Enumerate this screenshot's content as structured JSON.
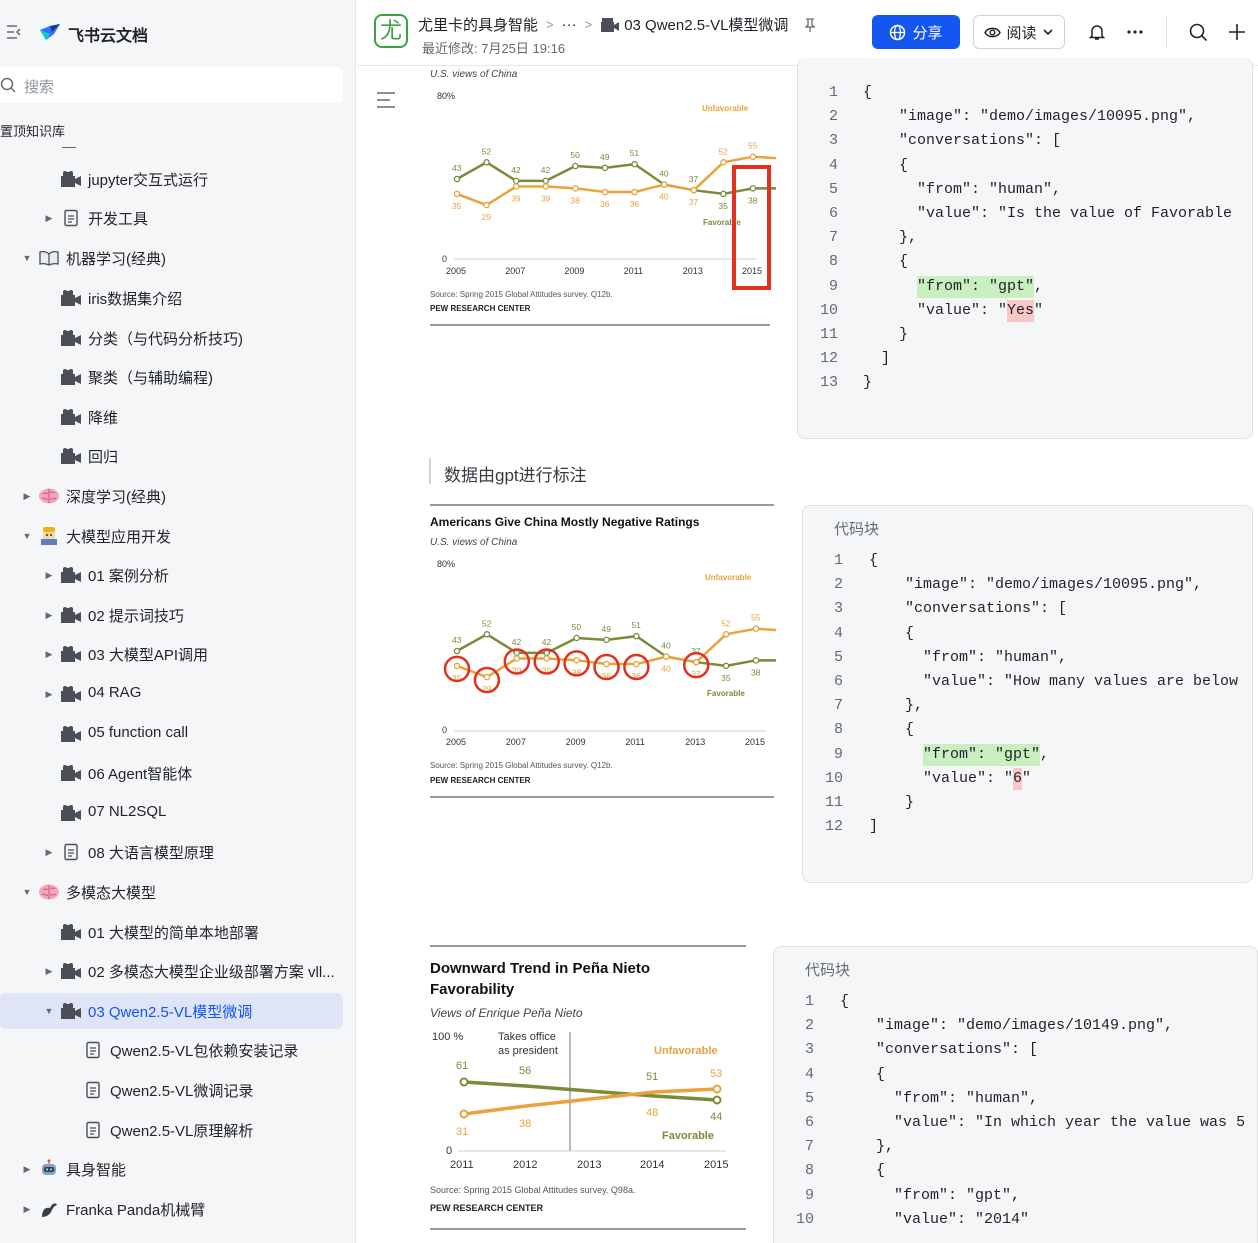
{
  "app": {
    "name": "飞书云文档"
  },
  "sidebar": {
    "search_placeholder": "搜索",
    "pinned_label": "置顶知识库",
    "items": [
      {
        "label": "jupyter交互式运行",
        "icon": "video-icon",
        "level": 2,
        "arrow": ""
      },
      {
        "label": "开发工具",
        "icon": "doc-icon",
        "level": 2,
        "arrow": "right"
      },
      {
        "label": "机器学习(经典)",
        "icon": "book-icon",
        "level": 1,
        "arrow": "down"
      },
      {
        "label": "iris数据集介绍",
        "icon": "video-icon",
        "level": 2,
        "arrow": ""
      },
      {
        "label": "分类（与代码分析技巧)",
        "icon": "video-icon",
        "level": 2,
        "arrow": ""
      },
      {
        "label": "聚类（与辅助编程)",
        "icon": "video-icon",
        "level": 2,
        "arrow": ""
      },
      {
        "label": "降维",
        "icon": "video-icon",
        "level": 2,
        "arrow": ""
      },
      {
        "label": "回归",
        "icon": "video-icon",
        "level": 2,
        "arrow": ""
      },
      {
        "label": "深度学习(经典)",
        "icon": "brain-icon",
        "level": 1,
        "arrow": "right"
      },
      {
        "label": "大模型应用开发",
        "icon": "robot-worker-icon",
        "level": 1,
        "arrow": "down"
      },
      {
        "label": "01 案例分析",
        "icon": "video-icon",
        "level": 2,
        "arrow": "right"
      },
      {
        "label": "02 提示词技巧",
        "icon": "video-icon",
        "level": 2,
        "arrow": "right"
      },
      {
        "label": "03 大模型API调用",
        "icon": "video-icon",
        "level": 2,
        "arrow": "right"
      },
      {
        "label": "04 RAG",
        "icon": "video-icon",
        "level": 2,
        "arrow": "right"
      },
      {
        "label": "05 function call",
        "icon": "video-icon",
        "level": 2,
        "arrow": ""
      },
      {
        "label": "06 Agent智能体",
        "icon": "video-icon",
        "level": 2,
        "arrow": ""
      },
      {
        "label": "07 NL2SQL",
        "icon": "video-icon",
        "level": 2,
        "arrow": ""
      },
      {
        "label": "08 大语言模型原理",
        "icon": "doc-icon",
        "level": 2,
        "arrow": "right"
      },
      {
        "label": "多模态大模型",
        "icon": "brain-icon",
        "level": 1,
        "arrow": "down"
      },
      {
        "label": "01 大模型的简单本地部署",
        "icon": "video-icon",
        "level": 2,
        "arrow": ""
      },
      {
        "label": "02 多模态大模型企业级部署方案 vll...",
        "icon": "video-icon",
        "level": 2,
        "arrow": "right"
      },
      {
        "label": "03 Qwen2.5-VL模型微调",
        "icon": "video-icon",
        "level": 2,
        "arrow": "down",
        "active": true
      },
      {
        "label": "Qwen2.5-VL包依赖安装记录",
        "icon": "doc-icon",
        "level": 3,
        "arrow": ""
      },
      {
        "label": "Qwen2.5-VL微调记录",
        "icon": "doc-icon",
        "level": 3,
        "arrow": ""
      },
      {
        "label": "Qwen2.5-VL原理解析",
        "icon": "doc-icon",
        "level": 3,
        "arrow": ""
      },
      {
        "label": "具身智能",
        "icon": "robot-icon",
        "level": 1,
        "arrow": "right"
      },
      {
        "label": "Franka Panda机械臂",
        "icon": "arm-icon",
        "level": 1,
        "arrow": "right"
      }
    ]
  },
  "topbar": {
    "avatar_char": "尤",
    "crumb_root": "尤里卡的具身智能",
    "crumb_ellipsis": "···",
    "crumb_current": "03 Qwen2.5-VL模型微调",
    "modified": "最近修改: 7月25日 19:16",
    "share_label": "分享",
    "read_label": "阅读"
  },
  "content": {
    "quote": "数据由gpt进行标注"
  },
  "figures": {
    "fig1": {
      "subtitle": "U.S. views of China",
      "ymax_label": "80%",
      "zero_label": "0",
      "unfavorable_label": "Unfavorable",
      "favorable_label": "Favorable",
      "source": "Source: Spring 2015 Global Attitudes survey. Q12b.",
      "org": "PEW RESEARCH CENTER",
      "years": [
        "2005",
        "2007",
        "2009",
        "2011",
        "2013",
        "2015"
      ],
      "unfavorable": [
        35,
        29,
        39,
        39,
        38,
        36,
        36,
        40,
        37,
        52,
        55,
        54
      ],
      "favorable": [
        43,
        52,
        42,
        42,
        50,
        49,
        51,
        40,
        37,
        35,
        38,
        38
      ]
    },
    "fig2": {
      "title": "Americans Give China Mostly Negative Ratings",
      "subtitle": "U.S. views of China",
      "ymax_label": "80%",
      "zero_label": "0",
      "unfavorable_label": "Unfavorable",
      "favorable_label": "Favorable",
      "source": "Source: Spring 2015 Global Attitudes survey. Q12b.",
      "org": "PEW RESEARCH CENTER",
      "years": [
        "2005",
        "2007",
        "2009",
        "2011",
        "2013",
        "2015"
      ]
    },
    "fig3": {
      "title_line1": "Downward Trend in Peña Nieto",
      "title_line2": "Favorability",
      "subtitle": "Views of Enrique Peña Nieto",
      "ymax_label": "100 %",
      "zero_label": "0",
      "office_line1": "Takes office",
      "office_line2": "as president",
      "unfavorable_label": "Unfavorable",
      "favorable_label": "Favorable",
      "source": "Source: Spring 2015 Global Attitudes survey. Q98a.",
      "org": "PEW RESEARCH CENTER",
      "years": [
        "2011",
        "2012",
        "2013",
        "2014",
        "2015"
      ],
      "unfav_values": [
        "61",
        "56",
        "51",
        "44"
      ],
      "fav_values": [
        "31",
        "38",
        "48",
        "53"
      ]
    }
  },
  "code_blocks": {
    "block1": {
      "lines": [
        "{",
        "    \"image\": \"demo/images/10095.png\",",
        "    \"conversations\": [",
        "    {",
        "      \"from\": \"human\",",
        "      \"value\": \"Is the value of Favorable",
        "    },",
        "    {",
        "      \"from\": \"gpt\",",
        "      \"value\": \"Yes\"",
        "    }",
        "  ]",
        "}"
      ]
    },
    "block2": {
      "title": "代码块",
      "lines": [
        "{",
        "    \"image\": \"demo/images/10095.png\",",
        "    \"conversations\": [",
        "    {",
        "      \"from\": \"human\",",
        "      \"value\": \"How many values are below",
        "    },",
        "    {",
        "      \"from\": \"gpt\",",
        "      \"value\": \"6\"",
        "    }",
        "]"
      ]
    },
    "block3": {
      "title": "代码块",
      "lines": [
        "{",
        "    \"image\": \"demo/images/10149.png\",",
        "    \"conversations\": [",
        "    {",
        "      \"from\": \"human\",",
        "      \"value\": \"In which year the value was 5",
        "    },",
        "    {",
        "      \"from\": \"gpt\",",
        "      \"value\": \"2014\""
      ]
    }
  },
  "colors": {
    "accent": "#1456f0",
    "unfavorable": "#e8a33d",
    "favorable": "#7a8b3a",
    "highlight_red": "#e0321f"
  }
}
